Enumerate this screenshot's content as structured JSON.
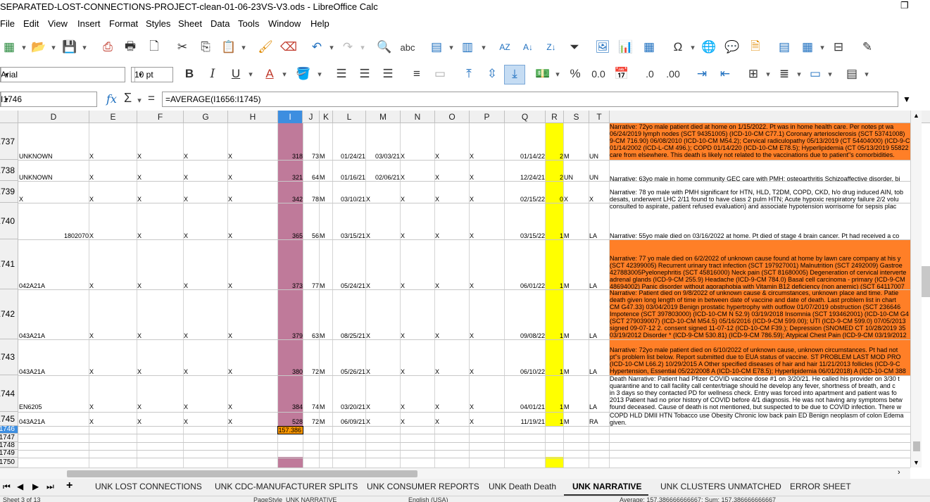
{
  "window": {
    "title": "SEPARATED-LOST-CONNECTIONS-PROJECT-clean-01-06-23VS-V3.ods - LibreOffice Calc"
  },
  "menu": [
    "File",
    "Edit",
    "View",
    "Insert",
    "Format",
    "Styles",
    "Sheet",
    "Data",
    "Tools",
    "Window",
    "Help"
  ],
  "toolbar": {
    "font_name": "Arial",
    "font_size": "10 pt"
  },
  "formula_bar": {
    "cell_ref": "I1746",
    "formula": "=AVERAGE(I1656:I1745)"
  },
  "columns": [
    "D",
    "E",
    "F",
    "G",
    "H",
    "I",
    "J",
    "K",
    "L",
    "M",
    "N",
    "O",
    "P",
    "Q",
    "R",
    "S",
    "T"
  ],
  "row_numbers": [
    "1737",
    "1738",
    "1739",
    "1740",
    "1741",
    "1742",
    "1743",
    "1744",
    "1745",
    "1746",
    "1747",
    "1748",
    "1749",
    "1750"
  ],
  "rows": [
    {
      "d": "UNKNOWN",
      "e": "X",
      "f": "X",
      "g": "X",
      "h": "X",
      "i": "318",
      "j": "73",
      "k": "M",
      "l": "01/24/21",
      "m": "03/03/21",
      "n": "X",
      "o": "X",
      "p": "X",
      "q": "01/14/22",
      "r": "2",
      "s": "M",
      "t": "UN",
      "narrative": "Narrative: 72yo male patient died at home on 1/15/2022. Pt was in home health care. Per notes pt wa\n06/24/2019 lymph nodes (SCT 94351005) (ICD-10-CM C77.1) Coronary arteriosclerosis (SCT 53741008)\n9-CM 716.90) 06/08/2010 (ICD-10-CM M54.2); Cervical radiculopathy 05/13/2019 (CT 54404000) (ICD-9-C\n01/14/2002 (ICD-L-CM 496.); COPD 01/14/220 (ICD-10-CM E78.5); Hyperlipidemia (CT 05/13/2019 55822\ncare from elsewhere. This death is likely not related to the vaccinations due to patient\"s comorbidities."
    },
    {
      "d": "UNKNOWN",
      "e": "X",
      "f": "X",
      "g": "X",
      "h": "X",
      "i": "321",
      "j": "64",
      "k": "M",
      "l": "01/16/21",
      "m": "02/06/21",
      "n": "X",
      "o": "X",
      "p": "X",
      "q": "12/24/21",
      "r": "2",
      "s": "UN",
      "t": "UN",
      "narrative": "Narrative: 63yo male in home community GEC care with PMH: osteoarthritis Schizoaffective disorder, bi"
    },
    {
      "d": "X",
      "e": "X",
      "f": "X",
      "g": "X",
      "h": "X",
      "i": "342",
      "j": "78",
      "k": "M",
      "l": "03/10/21",
      "m": "X",
      "n": "X",
      "o": "X",
      "p": "X",
      "q": "02/15/22",
      "r": "0",
      "s": "X",
      "t": "X",
      "narrative": "Narrative: 78 yo male with PMH significant for HTN, HLD, T2DM, COPD, CKD, h/o drug induced AIN, tob\ndesats, underwent LHC 2/11 found to have class 2 pulm HTN; Acute hypoxic respiratory failure 2/2 volu\nconsulted to aspirate, patient refused evaluation) and associate hypotension worrisome for sepsis plac"
    },
    {
      "d": "1802070",
      "e": "X",
      "f": "X",
      "g": "X",
      "h": "X",
      "i": "365",
      "j": "56",
      "k": "M",
      "l": "03/15/21",
      "m": "X",
      "n": "X",
      "o": "X",
      "p": "X",
      "q": "03/15/22",
      "r": "1",
      "s": "M",
      "t": "LA",
      "narrative": "Narrative: 55yo male died on 03/16/2022 at home. Pt died of stage 4 brain cancer. Pt had received a co"
    },
    {
      "d": "042A21A",
      "e": "X",
      "f": "X",
      "g": "X",
      "h": "X",
      "i": "373",
      "j": "77",
      "k": "M",
      "l": "05/24/21",
      "m": "X",
      "n": "X",
      "o": "X",
      "p": "X",
      "q": "06/01/22",
      "r": "1",
      "s": "M",
      "t": "LA",
      "narrative": "Narrative: 77 yo male died on 6/2/2022 of unknown cause found at home by lawn care company at his y\n(SCT 42399005) Recurrent urinary tract infection (SCT 197927001) Malnutrition (SCT 2492009) Gastroe\n427883005Pyelonephritis (SCT 45816000) Neck pain (SCT 81680005) Degeneration of cervical interverte\nadrenal glands (ICD-9-CM 255.9) Headache (ICD-9-CM 784.0) Basal cell carcinoma - primary (ICD-9-CM\n48694002) Panic disorder without agoraphobia with Vitamin B12 deficiency (non anemic) (SCT 64117007"
    },
    {
      "d": "043A21A",
      "e": "X",
      "f": "X",
      "g": "X",
      "h": "X",
      "i": "379",
      "j": "63",
      "k": "M",
      "l": "08/25/21",
      "m": "X",
      "n": "X",
      "o": "X",
      "p": "X",
      "q": "09/08/22",
      "r": "1",
      "s": "M",
      "t": "LA",
      "narrative": "Narrative: Patient died on 9/8/2022 of unknown cause & circumstances, unknown place and time. Patie\ndeath given long length of time in between date of vaccine and date of death. Last problem list in chart\nCM G47.33) 03/04/2019 Benign prostatic hypertrophy with outflow 01/07/2019 obstruction (SCT 236646\nImpotence (SCT 397803000) (ICD-10-CM N 52.9) 03/19/2018 Insomnia (SCT 193462001) (ICD-10-CM G4\n(SCT 279039007) (ICD-10-CM M54.5) 05/16/2016 (ICD-9-CM 599.00); UTI (ICD-9-CM 599.0) 07/05/2013\nsigned 09-07-12 2. consent signed 11-07-12 (ICD-10-CM F39.); Depression (SNOMED CT 10/28/2019 35\n03/19/2012 Disorder * (ICD-9-CM 530.81) (ICD-9-CM 786.59); Atypical Chest Pain (ICD-9-CM 03/19/2012"
    },
    {
      "d": "043A21A",
      "e": "X",
      "f": "X",
      "g": "X",
      "h": "X",
      "i": "380",
      "j": "72",
      "k": "M",
      "l": "05/26/21",
      "m": "X",
      "n": "X",
      "o": "X",
      "p": "X",
      "q": "06/10/22",
      "r": "1",
      "s": "M",
      "t": "LA",
      "narrative": "Narrative: 72yo male patient died on 6/10/2022 of unknown cause, unknown circumstances. Pt had not\npt\"s problem list below. Report submitted due to EUA status of vaccine. ST PROBLEM LAST MOD PRO\n(ICD-10-CM L66.2) 10/29/2015 A Other specified diseases of hair and hair 11/21/2013 follicles (ICD-9-C\nHypertension, Essential 05/22/2008 A (ICD-10-CM E78.5); Hyperlipidemia 06/01/2018) A (ICD-10-CM 388"
    },
    {
      "d": "EN6205",
      "e": "X",
      "f": "X",
      "g": "X",
      "h": "X",
      "i": "384",
      "j": "74",
      "k": "M",
      "l": "03/20/21",
      "m": "X",
      "n": "X",
      "o": "X",
      "p": "X",
      "q": "04/01/21",
      "r": "1",
      "s": "M",
      "t": "LA",
      "narrative": "Death Narrative: Patient had Pfizer COVID vaccine dose #1 on 3/20/21. He called his provider on 3/30 t\nquarantine and to call facility call center/triage should he develop any fever, shortness of breath, and c\nin 3 days so they contacted PD for wellness check. Entry was forced into apartment and patient was fo\n2013 Patient had no prior history of COVID before 4/1 diagnosis. He was not having any symptoms betw\nfound deceased. Cause of death is not mentioned, but suspected to be due to COVID infection. There w"
    },
    {
      "d": "043A21A",
      "e": "X",
      "f": "X",
      "g": "X",
      "h": "X",
      "i": "528",
      "j": "72",
      "k": "M",
      "l": "06/09/21",
      "m": "X",
      "n": "X",
      "o": "X",
      "p": "X",
      "q": "11/19/21",
      "r": "1",
      "s": "M",
      "t": "RA",
      "narrative": "COPD HLD DMII HTN Tobacco use Obesity Chronic low back pain ED Benign neoplasm of colon Edema\ngiven."
    }
  ],
  "average_cell": "157.386",
  "sheet_tabs": [
    "UNK LOST CONNECTIONS",
    "UNK CDC-MANUFACTURER SPLITS",
    "UNK CONSUMER REPORTS",
    "UNK Death Death",
    "UNK NARRATIVE",
    "UNK CLUSTERS UNMATCHED",
    "ERROR SHEET"
  ],
  "active_tab": "UNK NARRATIVE",
  "status": {
    "sheet": "Sheet 3 of 13",
    "page_style": "PageStyle_UNK NARRATIVE",
    "language": "English (USA)",
    "sum": "Average: 157.386666666667; Sum: 157.386666666667"
  },
  "colors": {
    "purple_col": "#bf7a9a",
    "yellow_col": "#ffff00",
    "orange_narr": "#ff7f27",
    "selection": "#3d8ee0"
  }
}
